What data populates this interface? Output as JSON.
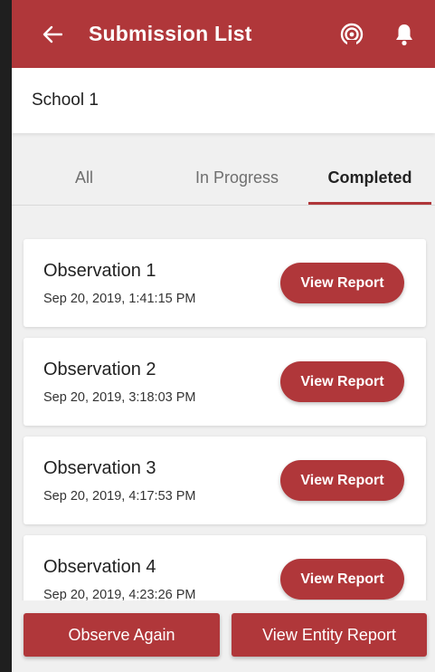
{
  "app_bar": {
    "title": "Submission List",
    "icons": [
      "back-arrow-icon",
      "broadcast-icon",
      "bell-icon"
    ],
    "background": "#b0373a"
  },
  "entity": {
    "name": "School 1"
  },
  "tabs": [
    {
      "label": "All",
      "active": false
    },
    {
      "label": "In Progress",
      "active": false
    },
    {
      "label": "Completed",
      "active": true
    }
  ],
  "submissions": [
    {
      "title": "Observation 1",
      "date": "Sep 20, 2019, 1:41:15 PM",
      "action": "View Report"
    },
    {
      "title": "Observation 2",
      "date": "Sep 20, 2019, 3:18:03 PM",
      "action": "View Report"
    },
    {
      "title": "Observation 3",
      "date": "Sep 20, 2019, 4:17:53 PM",
      "action": "View Report"
    },
    {
      "title": "Observation 4",
      "date": "Sep 20, 2019, 4:23:26 PM",
      "action": "View Report"
    }
  ],
  "footer": {
    "observe_again": "Observe Again",
    "view_entity_report": "View Entity Report"
  }
}
